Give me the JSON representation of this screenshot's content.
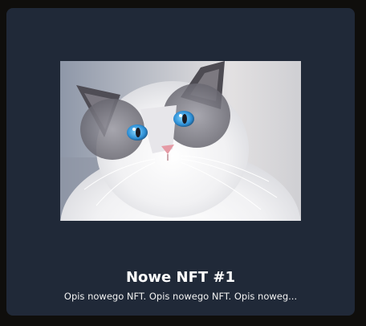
{
  "card": {
    "image_alt": "Ragdoll cat with blue eyes",
    "title": "Nowe NFT #1",
    "description": "Opis nowego NFT. Opis nowego NFT. Opis noweg..."
  },
  "colors": {
    "background": "#0f0e0c",
    "card": "#202938",
    "text": "#ffffff"
  }
}
